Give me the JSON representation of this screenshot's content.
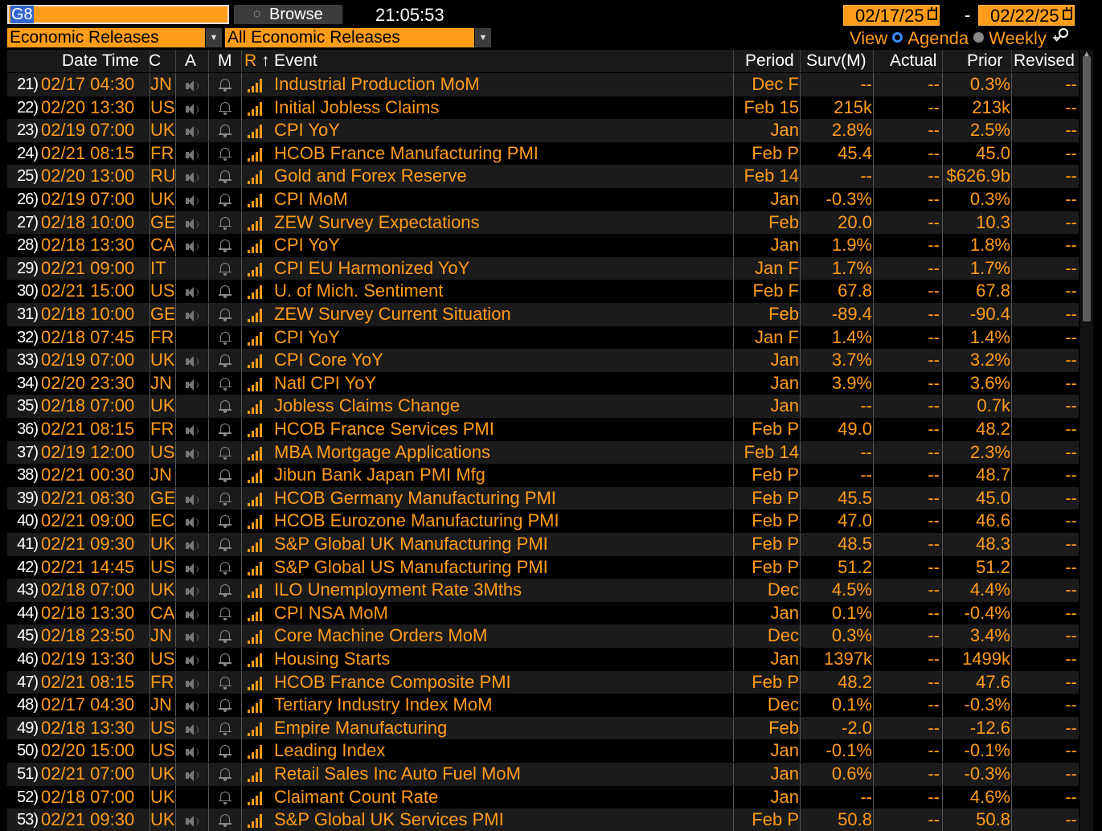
{
  "toolbar": {
    "command": "G8",
    "browse_label": "Browse",
    "clock": "21:05:53",
    "date_from": "02/17/25",
    "date_to": "02/22/25",
    "date_sep": "-",
    "filter_left": "Economic Releases",
    "filter_right": "All Economic Releases",
    "view_label": "View",
    "view_agenda": "Agenda",
    "view_weekly": "Weekly"
  },
  "columns": {
    "datetime": "Date Time",
    "country": "C",
    "alert": "A",
    "monitor": "M",
    "relevance": "R",
    "sort_arrow": "↑",
    "event": "Event",
    "period": "Period",
    "survey": "Surv(M)",
    "actual": "Actual",
    "prior": "Prior",
    "revised": "Revised"
  },
  "rows": [
    {
      "n": "21)",
      "dt": "02/17 04:30",
      "c": "JN",
      "spk": true,
      "ev": "Industrial Production MoM",
      "pe": "Dec F",
      "sv": "--",
      "ac": "--",
      "pr": "0.3%",
      "rv": "--"
    },
    {
      "n": "22)",
      "dt": "02/20 13:30",
      "c": "US",
      "spk": true,
      "ev": "Initial Jobless Claims",
      "pe": "Feb 15",
      "sv": "215k",
      "ac": "--",
      "pr": "213k",
      "rv": "--"
    },
    {
      "n": "23)",
      "dt": "02/19 07:00",
      "c": "UK",
      "spk": true,
      "ev": "CPI YoY",
      "pe": "Jan",
      "sv": "2.8%",
      "ac": "--",
      "pr": "2.5%",
      "rv": "--"
    },
    {
      "n": "24)",
      "dt": "02/21 08:15",
      "c": "FR",
      "spk": true,
      "ev": "HCOB France Manufacturing PMI",
      "pe": "Feb P",
      "sv": "45.4",
      "ac": "--",
      "pr": "45.0",
      "rv": "--"
    },
    {
      "n": "25)",
      "dt": "02/20 13:00",
      "c": "RU",
      "spk": true,
      "ev": "Gold and Forex Reserve",
      "pe": "Feb 14",
      "sv": "--",
      "ac": "--",
      "pr": "$626.9b",
      "rv": "--"
    },
    {
      "n": "26)",
      "dt": "02/19 07:00",
      "c": "UK",
      "spk": true,
      "ev": "CPI MoM",
      "pe": "Jan",
      "sv": "-0.3%",
      "ac": "--",
      "pr": "0.3%",
      "rv": "--"
    },
    {
      "n": "27)",
      "dt": "02/18 10:00",
      "c": "GE",
      "spk": true,
      "ev": "ZEW Survey Expectations",
      "pe": "Feb",
      "sv": "20.0",
      "ac": "--",
      "pr": "10.3",
      "rv": "--"
    },
    {
      "n": "28)",
      "dt": "02/18 13:30",
      "c": "CA",
      "spk": true,
      "ev": "CPI YoY",
      "pe": "Jan",
      "sv": "1.9%",
      "ac": "--",
      "pr": "1.8%",
      "rv": "--"
    },
    {
      "n": "29)",
      "dt": "02/21 09:00",
      "c": "IT",
      "spk": false,
      "ev": "CPI EU Harmonized YoY",
      "pe": "Jan F",
      "sv": "1.7%",
      "ac": "--",
      "pr": "1.7%",
      "rv": "--"
    },
    {
      "n": "30)",
      "dt": "02/21 15:00",
      "c": "US",
      "spk": true,
      "ev": "U. of Mich. Sentiment",
      "pe": "Feb F",
      "sv": "67.8",
      "ac": "--",
      "pr": "67.8",
      "rv": "--"
    },
    {
      "n": "31)",
      "dt": "02/18 10:00",
      "c": "GE",
      "spk": true,
      "ev": "ZEW Survey Current Situation",
      "pe": "Feb",
      "sv": "-89.4",
      "ac": "--",
      "pr": "-90.4",
      "rv": "--"
    },
    {
      "n": "32)",
      "dt": "02/18 07:45",
      "c": "FR",
      "spk": false,
      "ev": "CPI YoY",
      "pe": "Jan F",
      "sv": "1.4%",
      "ac": "--",
      "pr": "1.4%",
      "rv": "--"
    },
    {
      "n": "33)",
      "dt": "02/19 07:00",
      "c": "UK",
      "spk": true,
      "ev": "CPI Core YoY",
      "pe": "Jan",
      "sv": "3.7%",
      "ac": "--",
      "pr": "3.2%",
      "rv": "--"
    },
    {
      "n": "34)",
      "dt": "02/20 23:30",
      "c": "JN",
      "spk": true,
      "ev": "Natl CPI YoY",
      "pe": "Jan",
      "sv": "3.9%",
      "ac": "--",
      "pr": "3.6%",
      "rv": "--"
    },
    {
      "n": "35)",
      "dt": "02/18 07:00",
      "c": "UK",
      "spk": false,
      "ev": "Jobless Claims Change",
      "pe": "Jan",
      "sv": "--",
      "ac": "--",
      "pr": "0.7k",
      "rv": "--"
    },
    {
      "n": "36)",
      "dt": "02/21 08:15",
      "c": "FR",
      "spk": true,
      "ev": "HCOB France Services PMI",
      "pe": "Feb P",
      "sv": "49.0",
      "ac": "--",
      "pr": "48.2",
      "rv": "--"
    },
    {
      "n": "37)",
      "dt": "02/19 12:00",
      "c": "US",
      "spk": true,
      "ev": "MBA Mortgage Applications",
      "pe": "Feb 14",
      "sv": "--",
      "ac": "--",
      "pr": "2.3%",
      "rv": "--"
    },
    {
      "n": "38)",
      "dt": "02/21 00:30",
      "c": "JN",
      "spk": false,
      "ev": "Jibun Bank Japan PMI Mfg",
      "pe": "Feb P",
      "sv": "--",
      "ac": "--",
      "pr": "48.7",
      "rv": "--"
    },
    {
      "n": "39)",
      "dt": "02/21 08:30",
      "c": "GE",
      "spk": true,
      "ev": "HCOB Germany Manufacturing PMI",
      "pe": "Feb P",
      "sv": "45.5",
      "ac": "--",
      "pr": "45.0",
      "rv": "--"
    },
    {
      "n": "40)",
      "dt": "02/21 09:00",
      "c": "EC",
      "spk": true,
      "ev": "HCOB Eurozone Manufacturing PMI",
      "pe": "Feb P",
      "sv": "47.0",
      "ac": "--",
      "pr": "46.6",
      "rv": "--"
    },
    {
      "n": "41)",
      "dt": "02/21 09:30",
      "c": "UK",
      "spk": true,
      "ev": "S&P Global UK Manufacturing PMI",
      "pe": "Feb P",
      "sv": "48.5",
      "ac": "--",
      "pr": "48.3",
      "rv": "--"
    },
    {
      "n": "42)",
      "dt": "02/21 14:45",
      "c": "US",
      "spk": true,
      "ev": "S&P Global US Manufacturing PMI",
      "pe": "Feb P",
      "sv": "51.2",
      "ac": "--",
      "pr": "51.2",
      "rv": "--"
    },
    {
      "n": "43)",
      "dt": "02/18 07:00",
      "c": "UK",
      "spk": true,
      "ev": "ILO Unemployment Rate 3Mths",
      "pe": "Dec",
      "sv": "4.5%",
      "ac": "--",
      "pr": "4.4%",
      "rv": "--"
    },
    {
      "n": "44)",
      "dt": "02/18 13:30",
      "c": "CA",
      "spk": true,
      "ev": "CPI NSA MoM",
      "pe": "Jan",
      "sv": "0.1%",
      "ac": "--",
      "pr": "-0.4%",
      "rv": "--"
    },
    {
      "n": "45)",
      "dt": "02/18 23:50",
      "c": "JN",
      "spk": true,
      "ev": "Core Machine Orders MoM",
      "pe": "Dec",
      "sv": "0.3%",
      "ac": "--",
      "pr": "3.4%",
      "rv": "--"
    },
    {
      "n": "46)",
      "dt": "02/19 13:30",
      "c": "US",
      "spk": true,
      "ev": "Housing Starts",
      "pe": "Jan",
      "sv": "1397k",
      "ac": "--",
      "pr": "1499k",
      "rv": "--"
    },
    {
      "n": "47)",
      "dt": "02/21 08:15",
      "c": "FR",
      "spk": true,
      "ev": "HCOB France Composite PMI",
      "pe": "Feb P",
      "sv": "48.2",
      "ac": "--",
      "pr": "47.6",
      "rv": "--"
    },
    {
      "n": "48)",
      "dt": "02/17 04:30",
      "c": "JN",
      "spk": true,
      "ev": "Tertiary Industry Index MoM",
      "pe": "Dec",
      "sv": "0.1%",
      "ac": "--",
      "pr": "-0.3%",
      "rv": "--"
    },
    {
      "n": "49)",
      "dt": "02/18 13:30",
      "c": "US",
      "spk": true,
      "ev": "Empire Manufacturing",
      "pe": "Feb",
      "sv": "-2.0",
      "ac": "--",
      "pr": "-12.6",
      "rv": "--"
    },
    {
      "n": "50)",
      "dt": "02/20 15:00",
      "c": "US",
      "spk": true,
      "ev": "Leading Index",
      "pe": "Jan",
      "sv": "-0.1%",
      "ac": "--",
      "pr": "-0.1%",
      "rv": "--"
    },
    {
      "n": "51)",
      "dt": "02/21 07:00",
      "c": "UK",
      "spk": true,
      "ev": "Retail Sales Inc Auto Fuel MoM",
      "pe": "Jan",
      "sv": "0.6%",
      "ac": "--",
      "pr": "-0.3%",
      "rv": "--"
    },
    {
      "n": "52)",
      "dt": "02/18 07:00",
      "c": "UK",
      "spk": false,
      "ev": "Claimant Count Rate",
      "pe": "Jan",
      "sv": "--",
      "ac": "--",
      "pr": "4.6%",
      "rv": "--"
    },
    {
      "n": "53)",
      "dt": "02/21 09:30",
      "c": "UK",
      "spk": true,
      "ev": "S&P Global UK Services PMI",
      "pe": "Feb P",
      "sv": "50.8",
      "ac": "--",
      "pr": "50.8",
      "rv": "--"
    }
  ],
  "colors": {
    "accent": "#ff9c1a",
    "background": "#000000",
    "row_alt": "#1b1b1b",
    "radio_selected": "#3b8bff"
  }
}
